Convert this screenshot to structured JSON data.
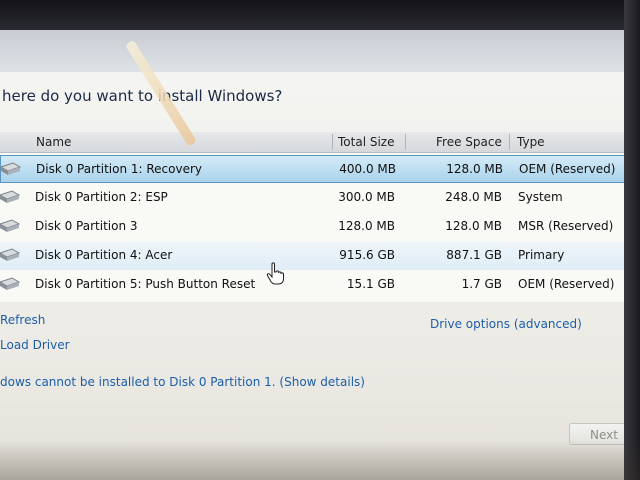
{
  "dialog": {
    "heading": "here do you want to install Windows?"
  },
  "table": {
    "columns": {
      "name": "Name",
      "total_size": "Total Size",
      "free_space": "Free Space",
      "type": "Type"
    },
    "rows": [
      {
        "name": "Disk 0 Partition 1: Recovery",
        "total": "400.0 MB",
        "free": "128.0 MB",
        "type": "OEM (Reserved)"
      },
      {
        "name": "Disk 0 Partition 2: ESP",
        "total": "300.0 MB",
        "free": "248.0 MB",
        "type": "System"
      },
      {
        "name": "Disk 0 Partition 3",
        "total": "128.0 MB",
        "free": "128.0 MB",
        "type": "MSR (Reserved)"
      },
      {
        "name": "Disk 0 Partition 4: Acer",
        "total": "915.6 GB",
        "free": "887.1 GB",
        "type": "Primary"
      },
      {
        "name": "Disk 0 Partition 5: Push Button Reset",
        "total": "15.1 GB",
        "free": "1.7 GB",
        "type": "OEM (Reserved)"
      }
    ]
  },
  "actions": {
    "refresh": "Refresh",
    "load_driver": "Load Driver",
    "drive_options": "Drive options (advanced)"
  },
  "warning": {
    "text": "dows cannot be installed to Disk 0 Partition 1.",
    "details_link": "(Show details)"
  },
  "buttons": {
    "next": "Next"
  },
  "colors": {
    "link": "#1d5ea8",
    "selection": "#a9d3ec",
    "heading": "#1c2a46"
  }
}
